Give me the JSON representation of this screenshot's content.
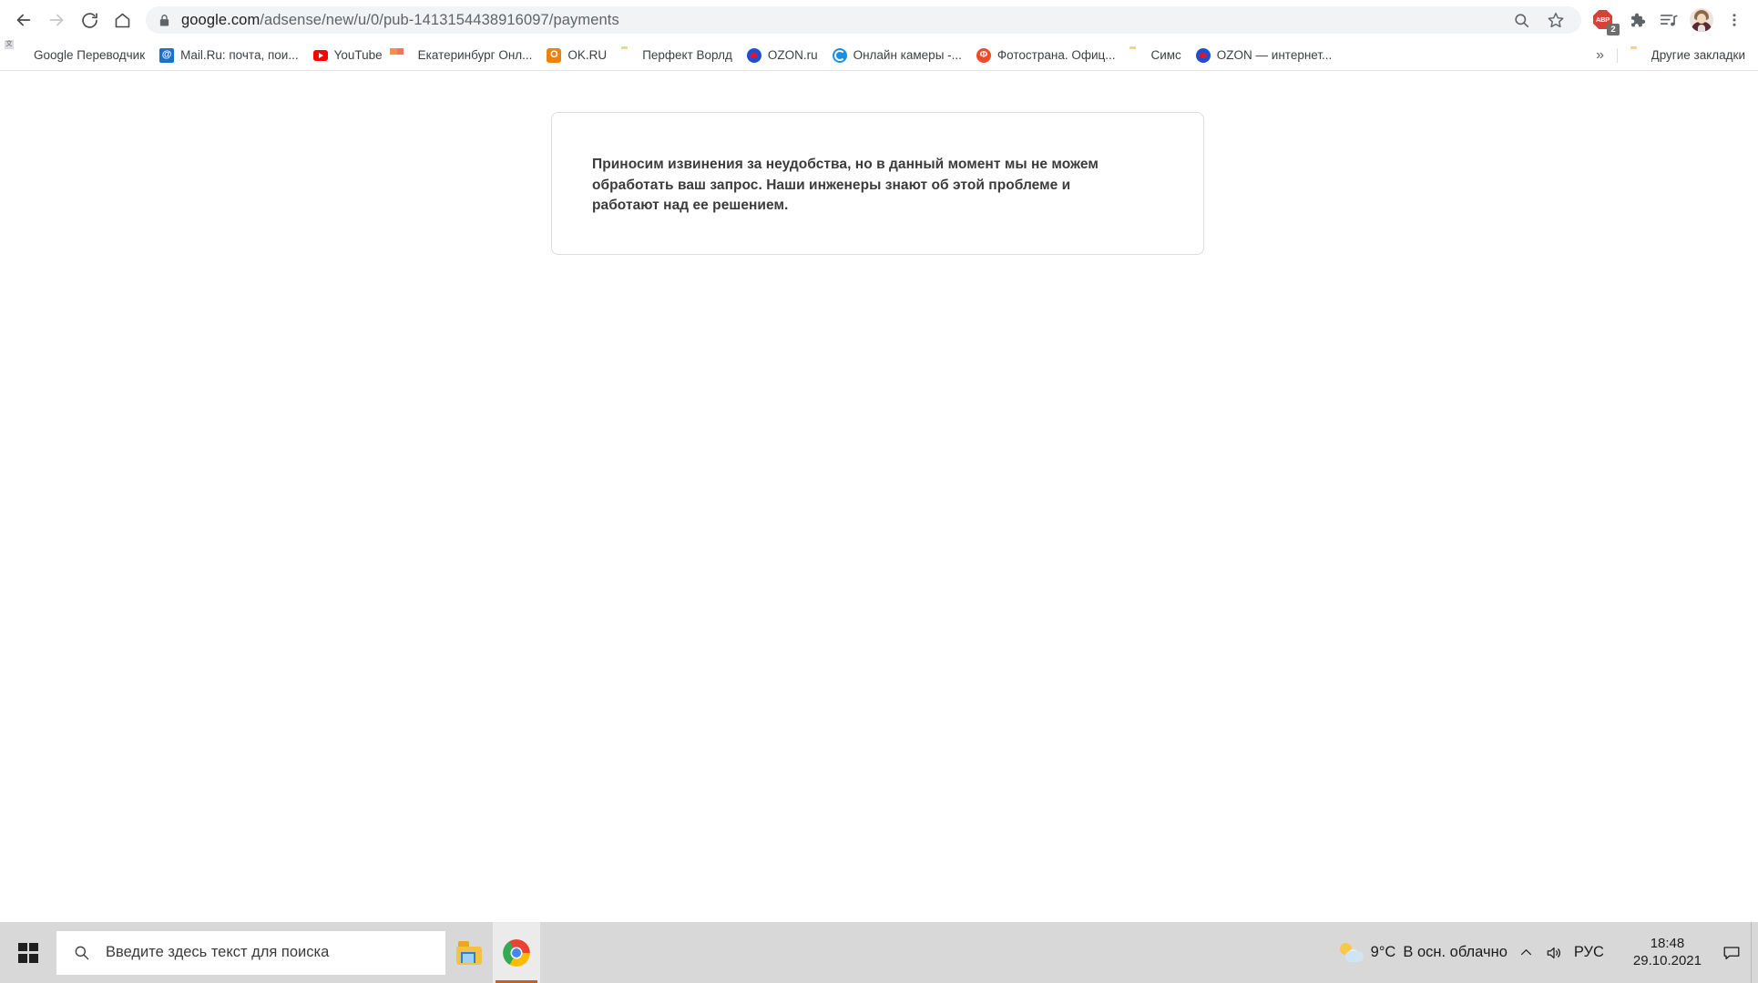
{
  "browser": {
    "nav": {
      "back_label": "Back",
      "forward_label": "Forward",
      "reload_label": "Reload",
      "home_label": "Home"
    },
    "omnibox": {
      "host": "google.com",
      "path": "/adsense/new/u/0/pub-1413154438916097/payments",
      "full_url": "google.com/adsense/new/u/0/pub-1413154438916097/payments",
      "security_icon": "lock-icon"
    },
    "toolbar_icons": [
      {
        "name": "search-icon",
        "label": "Search"
      },
      {
        "name": "bookmark-star-icon",
        "label": "Bookmark this tab"
      },
      {
        "name": "adblock-plus-icon",
        "label": "ABP",
        "badge": "2"
      },
      {
        "name": "extensions-puzzle-icon",
        "label": "Extensions"
      },
      {
        "name": "reading-list-icon",
        "label": "Reading list"
      },
      {
        "name": "profile-avatar-icon",
        "label": "Profile"
      },
      {
        "name": "chrome-menu-icon",
        "label": "Customize and control Google Chrome"
      }
    ],
    "bookmarks": [
      {
        "label": "Google Переводчик",
        "icon": "google-translate-icon"
      },
      {
        "label": "Mail.Ru: почта, пои...",
        "icon": "mailru-icon"
      },
      {
        "label": "YouTube",
        "icon": "youtube-icon"
      },
      {
        "label": "Екатеринбург Онл...",
        "icon": "e1-icon"
      },
      {
        "label": "OK.RU",
        "icon": "odnoklassniki-icon"
      },
      {
        "label": "Перфект Ворлд",
        "icon": "folder-icon"
      },
      {
        "label": "OZON.ru",
        "icon": "ozon-icon"
      },
      {
        "label": "Онлайн камеры -...",
        "icon": "camera-icon"
      },
      {
        "label": "Фотострана. Офиц...",
        "icon": "fotostrana-icon"
      },
      {
        "label": "Симс",
        "icon": "folder-icon"
      },
      {
        "label": "OZON — интернет...",
        "icon": "ozon-icon"
      }
    ],
    "bookmarks_overflow_label": "»",
    "other_bookmarks": {
      "label": "Другие закладки",
      "icon": "folder-icon"
    }
  },
  "page": {
    "error_message": "Приносим извинения за неудобства, но в данный момент мы не можем обработать ваш запрос. Наши инженеры знают об этой проблеме и работают над ее решением."
  },
  "taskbar": {
    "start_label": "Пуск",
    "search_placeholder": "Введите здесь текст для поиска",
    "apps": [
      {
        "name": "file-explorer",
        "label": "Проводник",
        "active": false
      },
      {
        "name": "google-chrome",
        "label": "Google Chrome",
        "active": true
      }
    ],
    "tray": {
      "weather_temp": "9°C",
      "weather_desc": "В осн. облачно",
      "overflow_label": "Показать скрытые значки",
      "volume_label": "Динамики",
      "language": "РУС",
      "time": "18:48",
      "date": "29.10.2021",
      "action_center_label": "Центр уведомлений"
    }
  },
  "colors": {
    "omnibox_bg": "#f1f3f4",
    "taskbar_bg": "#d8d8d8",
    "card_border": "#dddddd",
    "adblock_red": "#d9403a",
    "chrome_active_underline": "#c6611e"
  }
}
